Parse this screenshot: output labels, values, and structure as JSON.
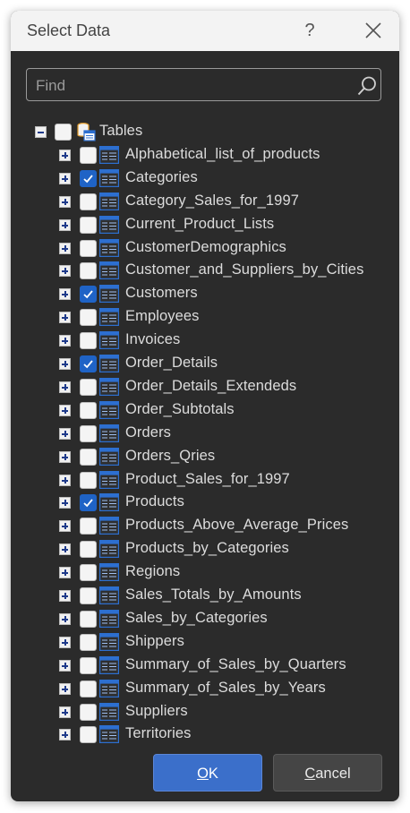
{
  "dialog": {
    "title": "Select Data",
    "help_label": "?",
    "search": {
      "placeholder": "Find",
      "value": ""
    },
    "root": {
      "label": "Tables",
      "expanded": true,
      "checked": false
    },
    "tables": [
      {
        "label": "Alphabetical_list_of_products",
        "checked": false
      },
      {
        "label": "Categories",
        "checked": true
      },
      {
        "label": "Category_Sales_for_1997",
        "checked": false
      },
      {
        "label": "Current_Product_Lists",
        "checked": false
      },
      {
        "label": "CustomerDemographics",
        "checked": false
      },
      {
        "label": "Customer_and_Suppliers_by_Cities",
        "checked": false
      },
      {
        "label": "Customers",
        "checked": true
      },
      {
        "label": "Employees",
        "checked": false
      },
      {
        "label": "Invoices",
        "checked": false
      },
      {
        "label": "Order_Details",
        "checked": true
      },
      {
        "label": "Order_Details_Extendeds",
        "checked": false
      },
      {
        "label": "Order_Subtotals",
        "checked": false
      },
      {
        "label": "Orders",
        "checked": false
      },
      {
        "label": "Orders_Qries",
        "checked": false
      },
      {
        "label": "Product_Sales_for_1997",
        "checked": false
      },
      {
        "label": "Products",
        "checked": true
      },
      {
        "label": "Products_Above_Average_Prices",
        "checked": false
      },
      {
        "label": "Products_by_Categories",
        "checked": false
      },
      {
        "label": "Regions",
        "checked": false
      },
      {
        "label": "Sales_Totals_by_Amounts",
        "checked": false
      },
      {
        "label": "Sales_by_Categories",
        "checked": false
      },
      {
        "label": "Shippers",
        "checked": false
      },
      {
        "label": "Summary_of_Sales_by_Quarters",
        "checked": false
      },
      {
        "label": "Summary_of_Sales_by_Years",
        "checked": false
      },
      {
        "label": "Suppliers",
        "checked": false
      },
      {
        "label": "Territories",
        "checked": false
      }
    ],
    "buttons": {
      "ok": {
        "prefix": "",
        "mnemonic": "O",
        "rest": "K"
      },
      "cancel": {
        "prefix": "",
        "mnemonic": "C",
        "rest": "ancel"
      }
    },
    "colors": {
      "background": "#2b2b2b",
      "titlebar": "#f3f3f3",
      "accent": "#3b6fca",
      "checked": "#1f63c6",
      "text": "#dcdcdc"
    }
  }
}
